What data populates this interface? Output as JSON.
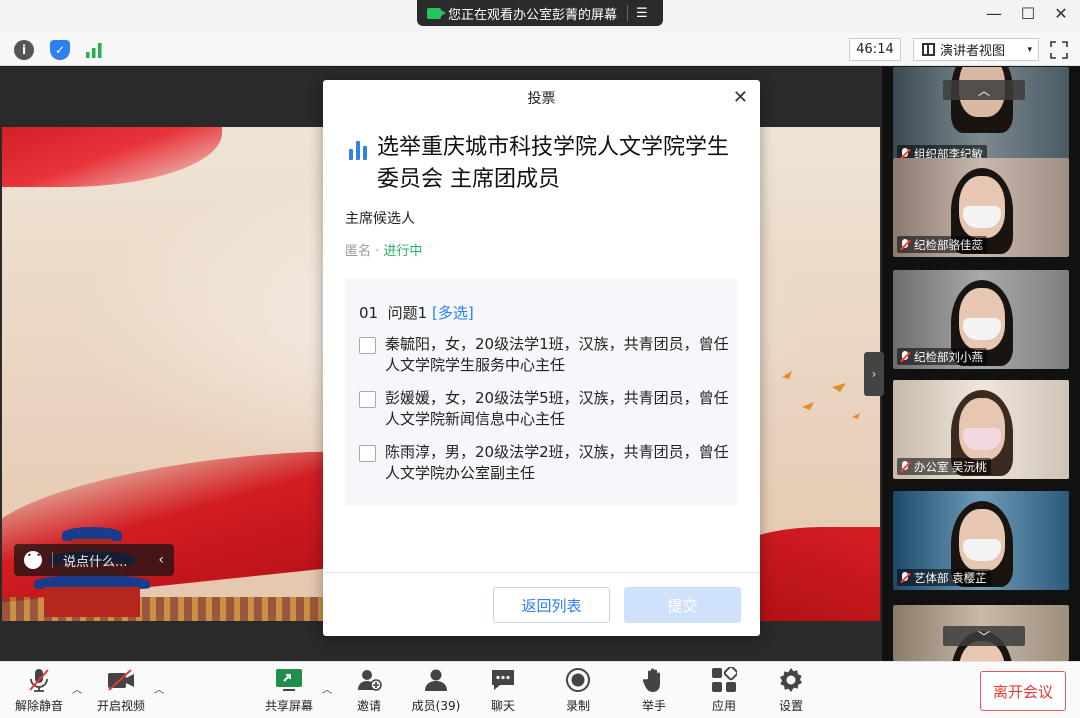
{
  "share_banner": {
    "text": "您正在观看办公室彭菁的屏幕",
    "menu_icon": "menu-icon"
  },
  "window_controls": {
    "minimize": "—",
    "maximize": "☐",
    "close": "✕"
  },
  "infobar": {
    "timer": "46:14",
    "view_label": "演讲者视图",
    "view_caret": "▾"
  },
  "slide_chat": {
    "placeholder": "说点什么...",
    "back": "‹"
  },
  "vote": {
    "header": "投票",
    "close": "✕",
    "title": "选举重庆城市科技学院人文学院学生委员会 主席团成员",
    "subtitle": "主席候选人",
    "meta_prefix": "匿名 · ",
    "meta_status": "进行中",
    "question": {
      "num": "01",
      "label": "问题1",
      "tag": "[多选]"
    },
    "options": [
      "秦毓阳，女，20级法学1班，汉族，共青团员，曾任人文学院学生服务中心主任",
      "彭媛媛，女，20级法学5班，汉族，共青团员，曾任人文学院新闻信息中心主任",
      "陈雨淳，男，20级法学2班，汉族，共青团员，曾任人文学院办公室副主任"
    ],
    "back_button": "返回列表",
    "submit_button": "提交"
  },
  "participants": [
    {
      "name": "组织部李纪敏"
    },
    {
      "name": "纪检部骆佳蕊"
    },
    {
      "name": "纪检部刘小燕"
    },
    {
      "name": "办公室 吴沅桃"
    },
    {
      "name": "艺体部 袁樱芷"
    }
  ],
  "strip_arrows": {
    "up": "︿",
    "down": "﹀",
    "handle": "›"
  },
  "toolbar": {
    "mute": "解除静音",
    "video": "开启视频",
    "share": "共享屏幕",
    "invite": "邀请",
    "members": "成员(39)",
    "chat": "聊天",
    "record": "录制",
    "raise_hand": "举手",
    "apps": "应用",
    "settings": "设置",
    "leave": "离开会议",
    "caret": "︿"
  },
  "colors": {
    "accent": "#2e7ff0",
    "status_green": "#27ae60",
    "leave_red": "#e53935"
  }
}
